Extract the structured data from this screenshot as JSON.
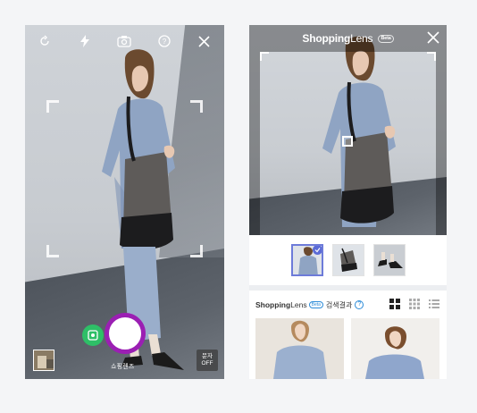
{
  "left_screen": {
    "toolbar": {
      "icons": [
        "rotate-icon",
        "flash-icon",
        "switch-camera-icon",
        "help-icon",
        "close-icon"
      ]
    },
    "mode_active": "쇼핑렌즈",
    "mode_inactive": "",
    "text_toggle_line1": "문자",
    "text_toggle_line2": "OFF"
  },
  "right_screen": {
    "header": {
      "title_bold": "Shopping",
      "title_light": "Lens",
      "badge": "Beta"
    },
    "thumbnails": [
      {
        "label": "thumb-top",
        "selected": true
      },
      {
        "label": "thumb-bag",
        "selected": false
      },
      {
        "label": "thumb-shoes",
        "selected": false
      }
    ],
    "results_bar": {
      "title_bold": "Shopping",
      "title_light": "Lens",
      "badge": "Beta",
      "label": "검색결과",
      "help": "?"
    },
    "view_modes": [
      "large-grid-icon",
      "small-grid-icon",
      "list-icon"
    ]
  },
  "colors": {
    "shutter_ring": "#9b1fb3",
    "lens_button": "#2ebf67",
    "accent_blue": "#5b6bd6",
    "badge_blue": "#2b8bd8"
  }
}
